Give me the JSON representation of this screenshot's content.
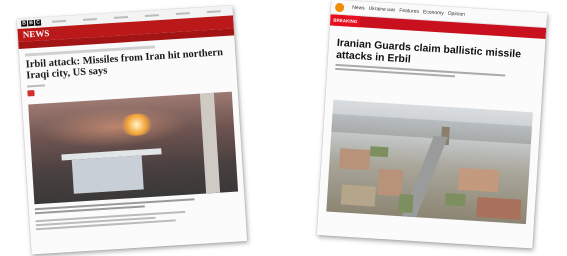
{
  "bbc": {
    "band_title": "NEWS",
    "headline": "Irbil attack: Missiles from Iran hit northern Iraqi city, US says"
  },
  "aljazeera": {
    "nav": [
      "News",
      "Ukraine war",
      "Features",
      "Economy",
      "Opinion"
    ],
    "breaking_tag": "BREAKING",
    "headline": "Iranian Guards claim ballistic missile attacks in Erbil"
  },
  "colors": {
    "bbc_red": "#bb1919",
    "aj_red": "#c8101e",
    "aj_orange": "#f18b00"
  }
}
